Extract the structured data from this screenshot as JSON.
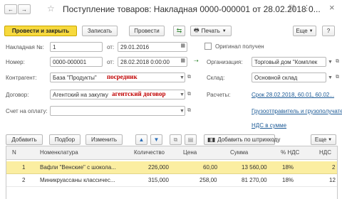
{
  "title": "Поступление товаров: Накладная 0000-000001 от 28.02.2018 0...",
  "nav": {
    "back": "←",
    "forward": "→",
    "star": "☆",
    "link": "🔗",
    "more": "⋮",
    "close": "×"
  },
  "toolbar": {
    "post_close": "Провести и закрыть",
    "save": "Записать",
    "post": "Провести",
    "print": "Печать",
    "more": "Еще",
    "help": "?"
  },
  "form": {
    "invoice_label": "Накладная №:",
    "invoice_value": "1",
    "from_label1": "от:",
    "from_value1": "29.01.2016",
    "original_label": "Оригинал получен",
    "number_label": "Номер:",
    "number_value": "0000-000001",
    "from_label2": "от:",
    "from_value2": "28.02.2018  0:00:00",
    "org_label": "Организация:",
    "org_value": "Торговый дом \"Комплек",
    "contractor_label": "Контрагент:",
    "contractor_value": "База \"Продукты\"",
    "contractor_note": "посредник",
    "warehouse_label": "Склад:",
    "warehouse_value": "Основной склад",
    "contract_label": "Договор:",
    "contract_value": "Агентский на закупку",
    "contract_note": "агентский договор",
    "settlements_label": "Расчеты:",
    "settlements_link": "Срок 28.02.2018, 60.01, 60.02...",
    "invoice_pay_label": "Счет на оплату:",
    "consignor_link": "Грузоотправитель и грузополучатель",
    "vat_link": "НДС в сумме"
  },
  "table_toolbar": {
    "add": "Добавить",
    "pick": "Подбор",
    "change": "Изменить",
    "up": "▲",
    "down": "▼",
    "barcode": "Добавить по штрихкоду",
    "more": "Еще"
  },
  "table": {
    "headers": [
      "N",
      "Номенклатура",
      "Количество",
      "Цена",
      "Сумма",
      "% НДС",
      "НДС"
    ],
    "rows": [
      [
        "1",
        "Вафли \"Венские\" с шокола...",
        "226,000",
        "60,00",
        "13 560,00",
        "18%",
        "2"
      ],
      [
        "2",
        "Миникруассаны классичес...",
        "315,000",
        "258,00",
        "81 270,00",
        "18%",
        "12"
      ]
    ]
  },
  "colors": {
    "primary": "#f7d93d",
    "link": "#1c5a96",
    "note": "#c00000",
    "selected_row": "#fbeea1"
  }
}
